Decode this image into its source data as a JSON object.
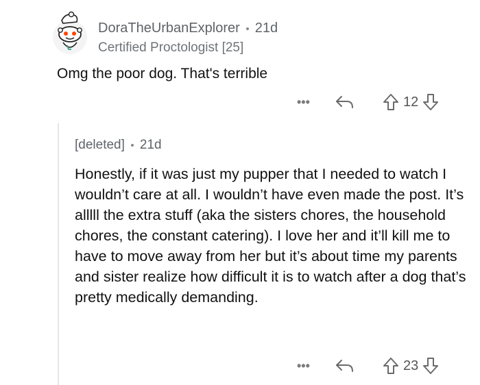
{
  "comment": {
    "author": "DoraTheUrbanExplorer",
    "age": "21d",
    "flair": "Certified Proctologist [25]",
    "body": "Omg the poor dog. That's terrible",
    "more_label": "•••",
    "score": "12"
  },
  "reply": {
    "author": "[deleted]",
    "age": "21d",
    "body": "Honestly, if it was just my pupper that I needed to watch I wouldn’t care at all. I wouldn’t have even made the post. It’s alllll the extra stuff (aka the sisters chores, the household chores, the constant catering). I love her and it’ll kill me to have to move away from her but it’s about time my parents and sister realize how difficult it is to watch after a dog that’s pretty medically demanding.",
    "more_label": "•••",
    "score": "23"
  },
  "icons": {
    "avatar": "snoo-avatar-icon",
    "reply": "reply-arrow-icon",
    "upvote": "upvote-arrow-icon",
    "downvote": "downvote-arrow-icon"
  },
  "colors": {
    "text": "#1c1c1c",
    "meta": "#5f6368",
    "thread_line": "#e6e6e6",
    "avatar_accent": "#ff4500"
  }
}
